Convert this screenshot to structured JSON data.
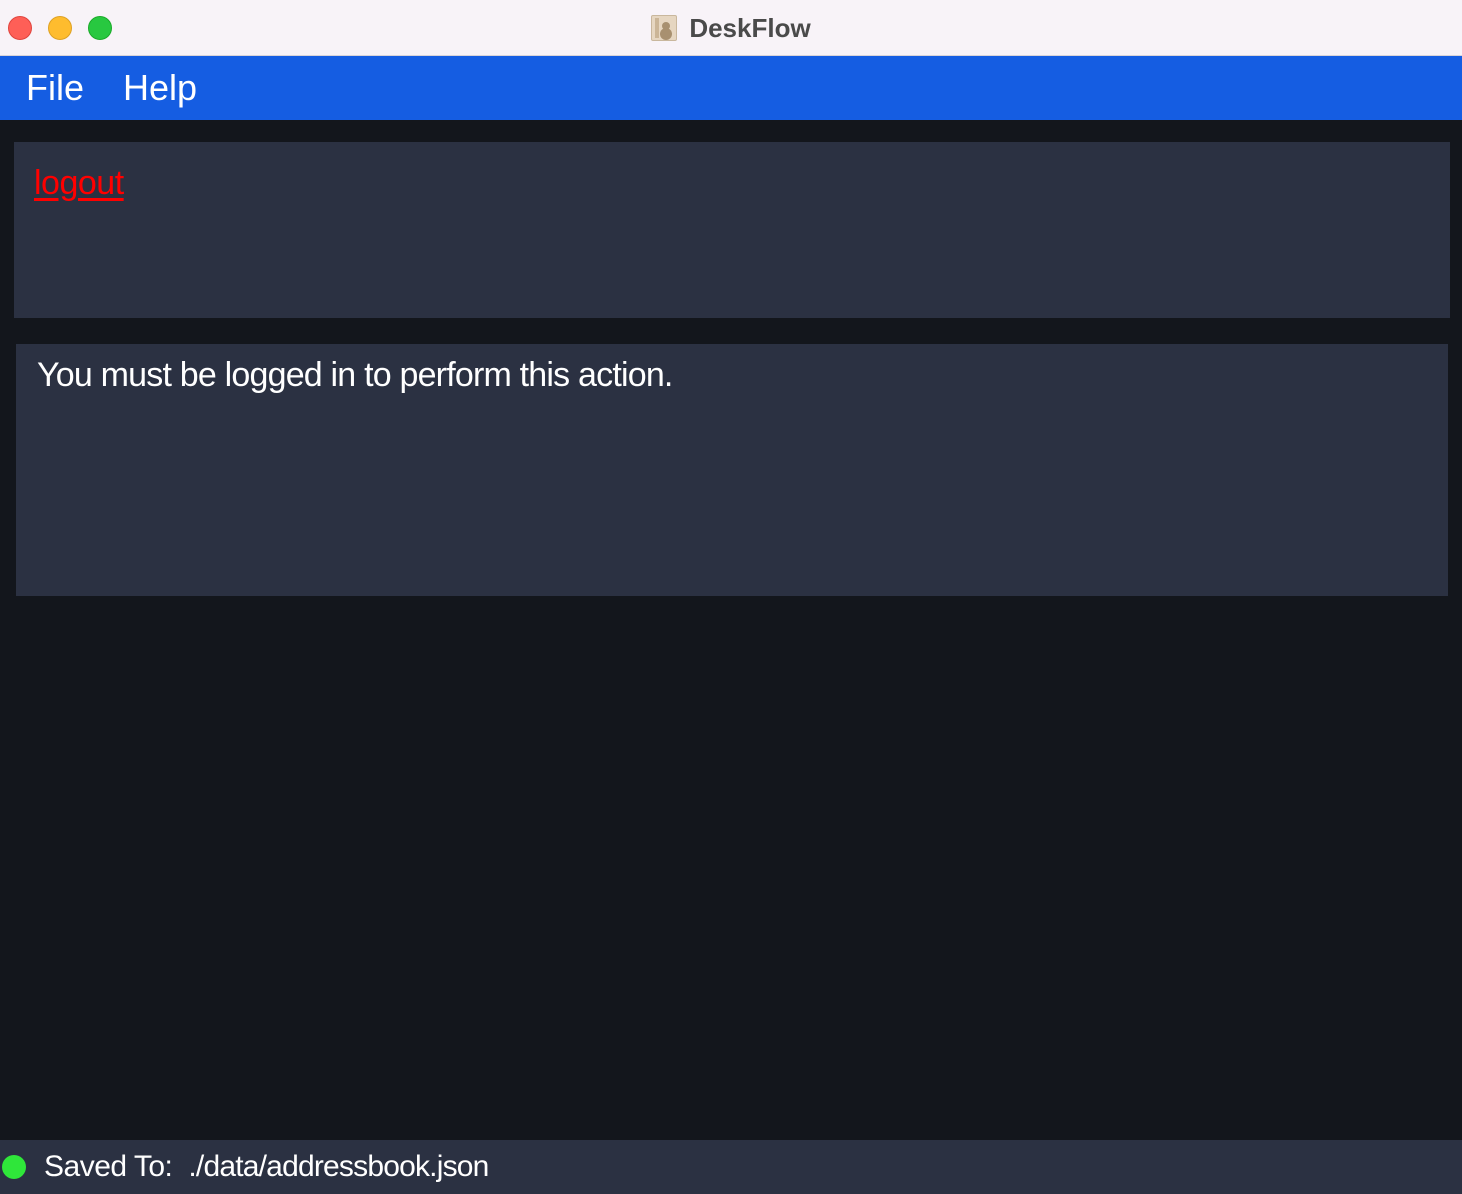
{
  "window": {
    "title": "DeskFlow",
    "app_icon": "address-book-icon"
  },
  "menubar": {
    "items": [
      {
        "label": "File"
      },
      {
        "label": "Help"
      }
    ]
  },
  "command_box": {
    "value": "logout",
    "value_color": "#ff0000"
  },
  "result_display": {
    "message": "You must be logged in to perform this action."
  },
  "status_bar": {
    "label": "Saved To:",
    "path": "./data/addressbook.json",
    "indicator_color": "#2fe63a"
  },
  "colors": {
    "menubar_bg": "#155de2",
    "panel_bg": "#2b3142",
    "window_bg": "#13161c"
  }
}
